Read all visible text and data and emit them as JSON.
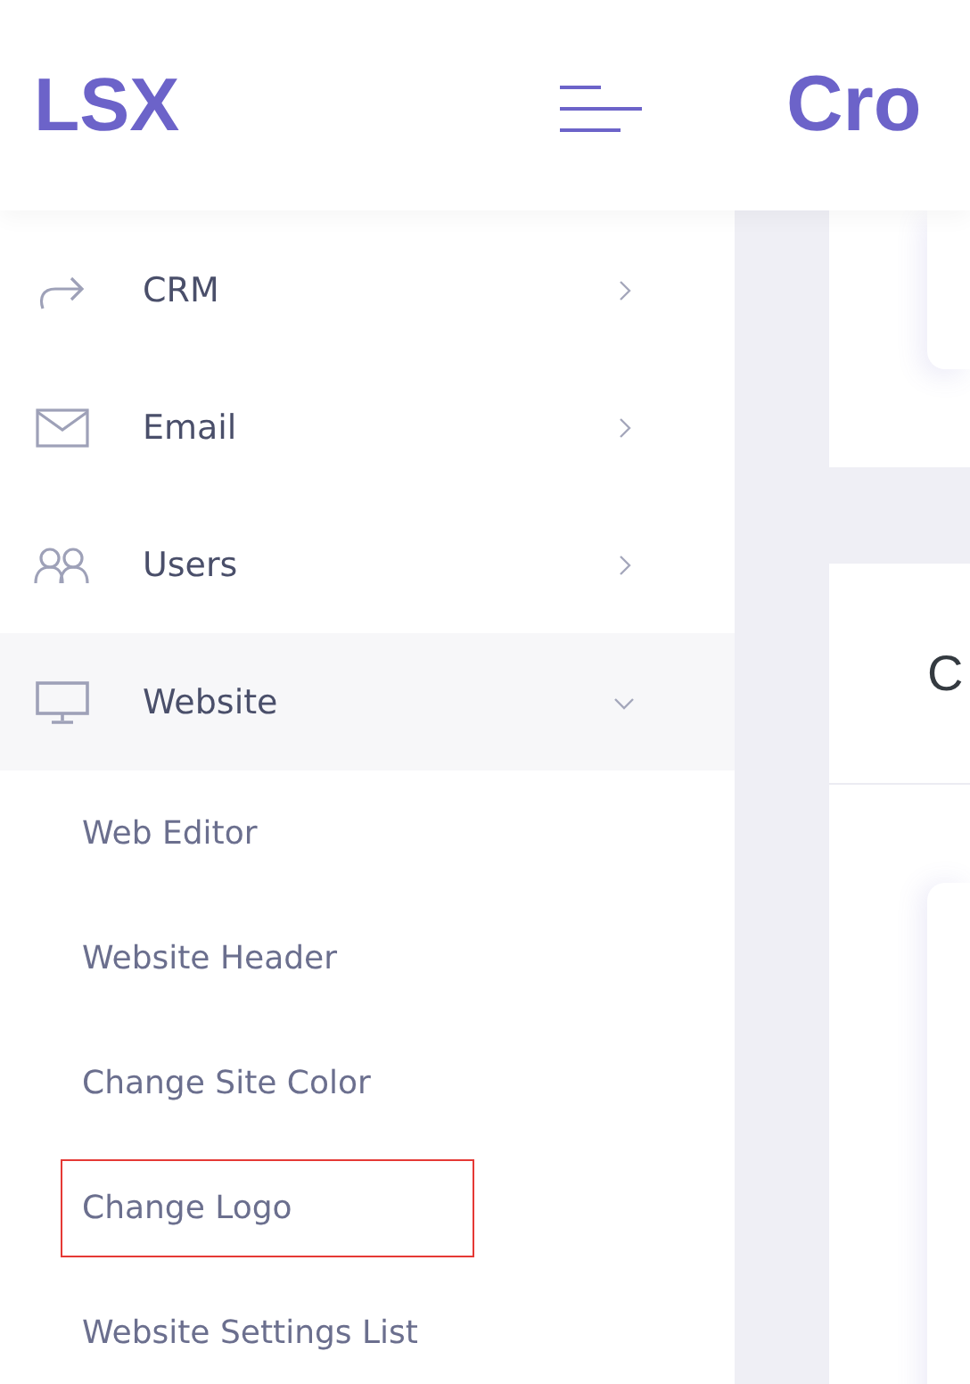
{
  "header": {
    "logo": "LSX",
    "page_title": "Cro"
  },
  "sidebar": {
    "items": [
      {
        "label": "CRM",
        "kind": "share",
        "expanded": false
      },
      {
        "label": "Email",
        "kind": "mail",
        "expanded": false
      },
      {
        "label": "Users",
        "kind": "users",
        "expanded": false
      },
      {
        "label": "Website",
        "kind": "monitor",
        "expanded": true,
        "children": [
          {
            "label": "Web Editor",
            "highlighted": false
          },
          {
            "label": "Website Header",
            "highlighted": false
          },
          {
            "label": "Change Site Color",
            "highlighted": false
          },
          {
            "label": "Change Logo",
            "highlighted": true
          },
          {
            "label": "Website Settings List",
            "highlighted": false
          }
        ]
      }
    ]
  },
  "content": {
    "card_title": "C"
  }
}
